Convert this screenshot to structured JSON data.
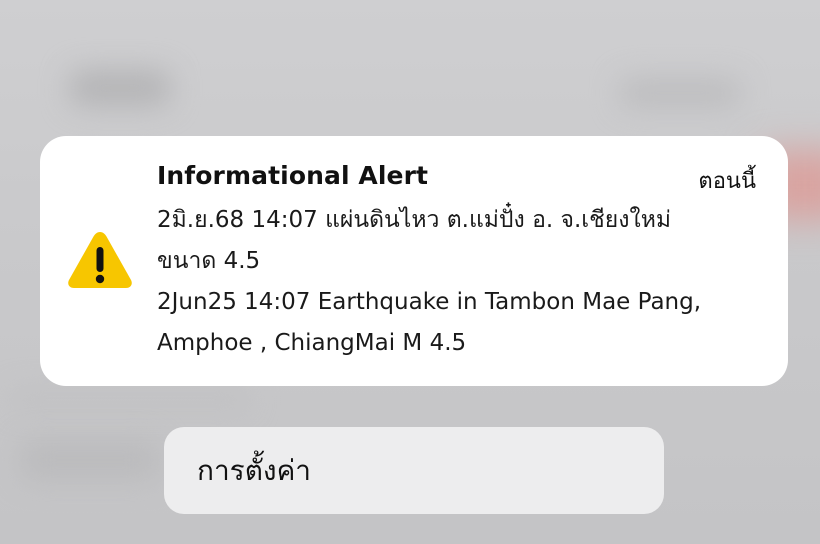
{
  "alert": {
    "title": "Informational Alert",
    "time": "ตอนนี้",
    "body_lines": [
      "2มิ.ย.68 14:07 แผ่นดินไหว ต.แม่ปั๋ง อ. จ.เชียงใหม่",
      "ขนาด 4.5",
      "2Jun25 14:07 Earthquake in Tambon Mae Pang,",
      "Amphoe , ChiangMai M 4.5"
    ],
    "icon": "warning-triangle-icon",
    "icon_color": "#F7C600"
  },
  "actions": {
    "settings_label": "การตั้งค่า"
  }
}
